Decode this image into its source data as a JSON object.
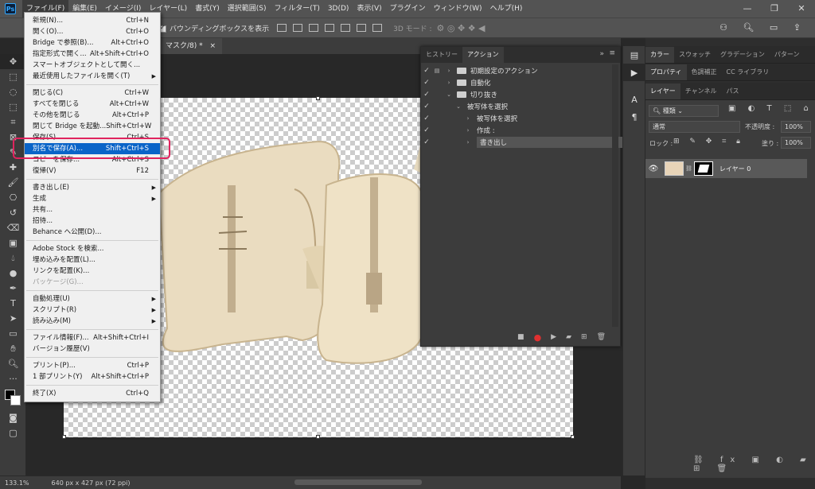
{
  "menubar": {
    "items": [
      "ファイル(F)",
      "編集(E)",
      "イメージ(I)",
      "レイヤー(L)",
      "書式(Y)",
      "選択範囲(S)",
      "フィルター(T)",
      "3D(D)",
      "表示(V)",
      "プラグイン",
      "ウィンドウ(W)",
      "ヘルプ(H)"
    ],
    "logo": "Ps",
    "window_controls": [
      "—",
      "❐",
      "✕"
    ]
  },
  "options": {
    "bounding_box_label": "バウンディングボックスを表示",
    "mode_3d_label": "3D モード :"
  },
  "document": {
    "tab_title": "マスク/8) *",
    "tab_close": "×"
  },
  "file_menu": {
    "items": [
      {
        "label": "新規(N)...",
        "shortcut": "Ctrl+N"
      },
      {
        "label": "開く(O)...",
        "shortcut": "Ctrl+O"
      },
      {
        "label": "Bridge で参照(B)...",
        "shortcut": "Alt+Ctrl+O"
      },
      {
        "label": "指定形式で開く...",
        "shortcut": "Alt+Shift+Ctrl+O"
      },
      {
        "label": "スマートオブジェクトとして開く...",
        "shortcut": ""
      },
      {
        "label": "最近使用したファイルを開く(T)",
        "shortcut": "",
        "submenu": true
      },
      {
        "sep": true
      },
      {
        "label": "閉じる(C)",
        "shortcut": "Ctrl+W"
      },
      {
        "label": "すべてを閉じる",
        "shortcut": "Alt+Ctrl+W"
      },
      {
        "label": "その他を閉じる",
        "shortcut": "Alt+Ctrl+P"
      },
      {
        "label": "閉じて Bridge を起動...",
        "shortcut": "Shift+Ctrl+W"
      },
      {
        "label": "保存(S)",
        "shortcut": "Ctrl+S"
      },
      {
        "label": "別名で保存(A)...",
        "shortcut": "Shift+Ctrl+S",
        "highlight": true
      },
      {
        "label": "コピーを保存...",
        "shortcut": "Alt+Ctrl+S"
      },
      {
        "label": "復帰(V)",
        "shortcut": "F12"
      },
      {
        "sep": true
      },
      {
        "label": "書き出し(E)",
        "shortcut": "",
        "submenu": true
      },
      {
        "label": "生成",
        "shortcut": "",
        "submenu": true
      },
      {
        "label": "共有...",
        "shortcut": ""
      },
      {
        "label": "招待...",
        "shortcut": ""
      },
      {
        "label": "Behance へ公開(D)...",
        "shortcut": ""
      },
      {
        "sep": true
      },
      {
        "label": "Adobe Stock を検索...",
        "shortcut": ""
      },
      {
        "label": "埋め込みを配置(L)...",
        "shortcut": ""
      },
      {
        "label": "リンクを配置(K)...",
        "shortcut": ""
      },
      {
        "label": "パッケージ(G)...",
        "shortcut": "",
        "disabled": true
      },
      {
        "sep": true
      },
      {
        "label": "自動処理(U)",
        "shortcut": "",
        "submenu": true
      },
      {
        "label": "スクリプト(R)",
        "shortcut": "",
        "submenu": true
      },
      {
        "label": "読み込み(M)",
        "shortcut": "",
        "submenu": true
      },
      {
        "sep": true
      },
      {
        "label": "ファイル情報(F)...",
        "shortcut": "Alt+Shift+Ctrl+I"
      },
      {
        "label": "バージョン履歴(V)",
        "shortcut": ""
      },
      {
        "sep": true
      },
      {
        "label": "プリント(P)...",
        "shortcut": "Ctrl+P"
      },
      {
        "label": "1 部プリント(Y)",
        "shortcut": "Alt+Shift+Ctrl+P"
      },
      {
        "sep": true
      },
      {
        "label": "終了(X)",
        "shortcut": "Ctrl+Q"
      }
    ]
  },
  "actions_panel": {
    "tabs": [
      "ヒストリー",
      "アクション"
    ],
    "collapse": "»",
    "rows": [
      {
        "label": "初期設定のアクション",
        "indent": 0,
        "folder": true,
        "twisty": "›",
        "dialog": true
      },
      {
        "label": "自動化",
        "indent": 0,
        "folder": true,
        "twisty": "›"
      },
      {
        "label": "切り抜き",
        "indent": 0,
        "folder": true,
        "twisty": "⌄"
      },
      {
        "label": "被写体を選択",
        "indent": 1,
        "twisty": "⌄"
      },
      {
        "label": "被写体を選択",
        "indent": 2,
        "twisty": "›"
      },
      {
        "label": "作成 :",
        "indent": 2,
        "twisty": "›"
      },
      {
        "label": "書き出し",
        "indent": 2,
        "twisty": "›",
        "selected": true
      }
    ]
  },
  "right_panels": {
    "color_tabs": [
      "カラー",
      "スウォッチ",
      "グラデーション",
      "パターン"
    ],
    "props_tabs": [
      "プロパティ",
      "色調補正",
      "CC ライブラリ"
    ],
    "layer_tabs": [
      "レイヤー",
      "チャンネル",
      "パス"
    ],
    "kind_label": "種類",
    "blend_mode": "通常",
    "opacity_label": "不透明度 :",
    "opacity_value": "100%",
    "lock_label": "ロック :",
    "fill_label": "塗り :",
    "fill_value": "100%",
    "layer_name": "レイヤー 0"
  },
  "status": {
    "zoom": "133.1%",
    "doc_info": "640 px x 427 px (72 ppi)"
  },
  "colors": {
    "highlight_frame": "#e0245e",
    "menu_highlight": "#0a64c8",
    "record_button": "#e03030"
  }
}
